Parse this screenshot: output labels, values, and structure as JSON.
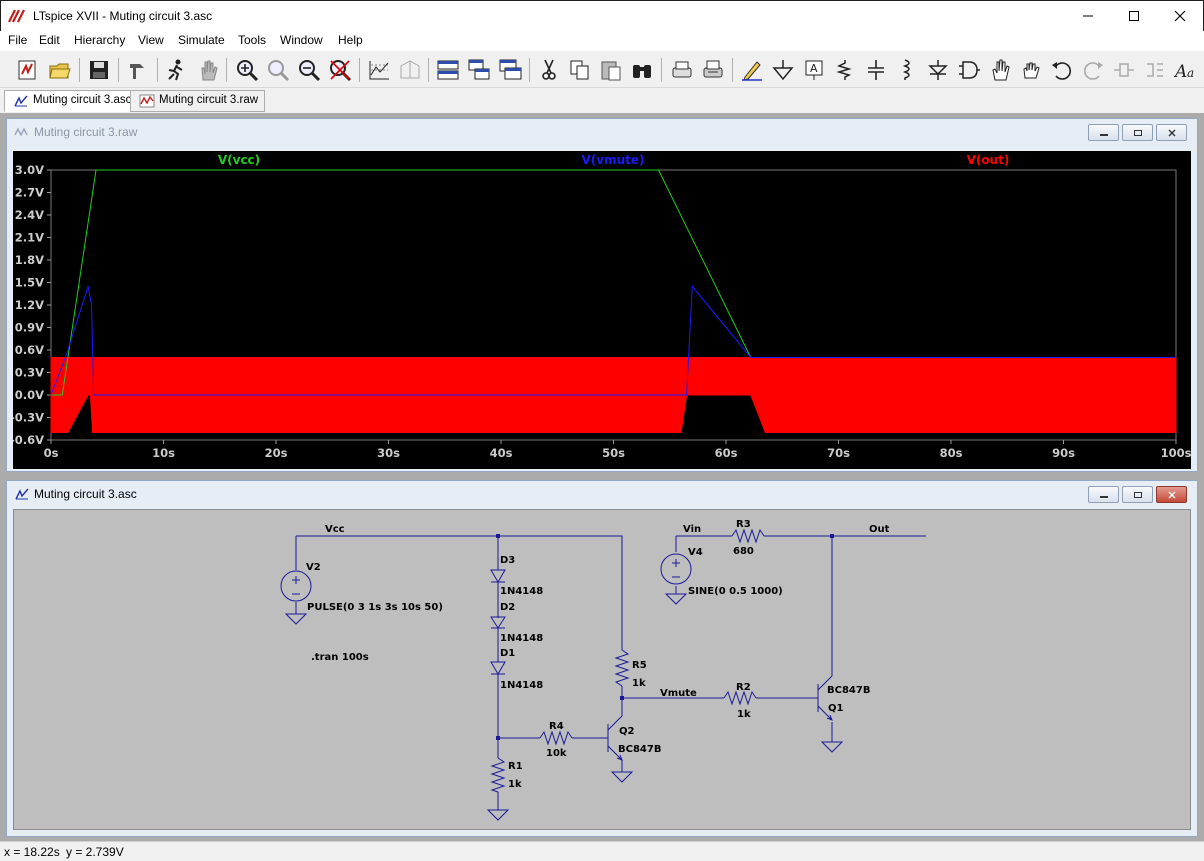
{
  "window": {
    "title": "LTspice XVII - Muting circuit 3.asc",
    "controls": {
      "minimize": "minimize-icon",
      "maximize": "maximize-icon",
      "close": "close-icon"
    }
  },
  "menu": [
    "File",
    "Edit",
    "Hierarchy",
    "View",
    "Simulate",
    "Tools",
    "Window",
    "Help"
  ],
  "toolbar": {
    "icons": [
      "new-schematic-icon",
      "open-icon",
      "save-icon",
      "control-panel-icon",
      "run-icon",
      "halt-icon",
      "zoom-in-icon",
      "zoom-pan-icon",
      "zoom-out-icon",
      "zoom-fit-icon",
      "autorange-icon",
      "grid-icon",
      "tile-horizontal-icon",
      "cascade-icon",
      "tile-vertical-icon",
      "cut-icon",
      "copy-icon",
      "paste-icon",
      "find-icon",
      "print-setup-icon",
      "print-icon",
      "draw-wire-icon",
      "ground-icon",
      "label-net-icon",
      "resistor-icon",
      "capacitor-icon",
      "inductor-icon",
      "diode-icon",
      "component-icon",
      "move-icon",
      "drag-icon",
      "undo-icon",
      "redo-icon",
      "rotate-icon",
      "mirror-icon",
      "text-icon"
    ]
  },
  "tabs": [
    {
      "label": "Muting circuit 3.asc",
      "icon": "schematic-icon",
      "active": true
    },
    {
      "label": "Muting circuit 3.raw",
      "icon": "waveform-icon",
      "active": false
    }
  ],
  "plot_window": {
    "title": "Muting circuit 3.raw"
  },
  "schematic_window": {
    "title": "Muting circuit 3.asc"
  },
  "chart_data": {
    "type": "line",
    "xlabel": "",
    "ylabel": "",
    "xlim": [
      0,
      100
    ],
    "ylim": [
      -0.6,
      3.0
    ],
    "x_ticks": [
      "0s",
      "10s",
      "20s",
      "30s",
      "40s",
      "50s",
      "60s",
      "70s",
      "80s",
      "90s",
      "100s"
    ],
    "x_tick_values": [
      0,
      10,
      20,
      30,
      40,
      50,
      60,
      70,
      80,
      90,
      100
    ],
    "y_ticks": [
      "3.0V",
      "2.7V",
      "2.4V",
      "2.1V",
      "1.8V",
      "1.5V",
      "1.2V",
      "0.9V",
      "0.6V",
      "0.3V",
      "0.0V",
      "-0.3V",
      "-0.6V"
    ],
    "y_tick_values": [
      3.0,
      2.7,
      2.4,
      2.1,
      1.8,
      1.5,
      1.2,
      0.9,
      0.6,
      0.3,
      0.0,
      -0.3,
      -0.6
    ],
    "series": [
      {
        "name": "V(vcc)",
        "color": "#22cc22",
        "x": [
          0,
          1,
          4,
          54,
          62.2,
          100
        ],
        "y": [
          0,
          0,
          3.0,
          3.0,
          0.5,
          0.5
        ]
      },
      {
        "name": "V(vmute)",
        "color": "#1a1aff",
        "x": [
          0,
          1.4,
          3.3,
          3.6,
          3.8,
          56.5,
          57,
          62.2,
          100
        ],
        "y": [
          0,
          0.55,
          1.45,
          1.2,
          0,
          0,
          1.45,
          0.5,
          0.5
        ]
      },
      {
        "name": "V(out)",
        "color": "#ff0000",
        "envelope": true,
        "x": [
          0,
          1.5,
          3.3,
          3.5,
          3.7,
          56.0,
          56.5,
          62.2,
          63.5,
          100
        ],
        "upper": [
          0.5,
          0.5,
          0.5,
          0.5,
          0.5,
          0.5,
          0.5,
          0.5,
          0.5,
          0.5
        ],
        "lower": [
          -0.5,
          -0.5,
          0.0,
          0.0,
          -0.5,
          -0.5,
          0.0,
          0.0,
          -0.5,
          -0.5
        ]
      }
    ]
  },
  "schematic": {
    "nets": [
      "Vcc",
      "Vin",
      "Out",
      "Vmute"
    ],
    "components": [
      {
        "ref": "V2",
        "value": "PULSE(0 3 1s 3s 10s 50)"
      },
      {
        "ref": "V4",
        "value": "SINE(0 0.5 1000)"
      },
      {
        "ref": "R3",
        "value": "680"
      },
      {
        "ref": "D3",
        "value": "1N4148"
      },
      {
        "ref": "D2",
        "value": "1N4148"
      },
      {
        "ref": "D1",
        "value": "1N4148"
      },
      {
        "ref": "R5",
        "value": "1k"
      },
      {
        "ref": "R2",
        "value": "1k"
      },
      {
        "ref": "R4",
        "value": "10k"
      },
      {
        "ref": "R1",
        "value": "1k"
      },
      {
        "ref": "Q2",
        "value": "BC847B"
      },
      {
        "ref": "Q1",
        "value": "BC847B"
      }
    ],
    "directive": ".tran 100s"
  },
  "status": {
    "x": "x = 18.22s",
    "y": "y = 2.739V"
  }
}
